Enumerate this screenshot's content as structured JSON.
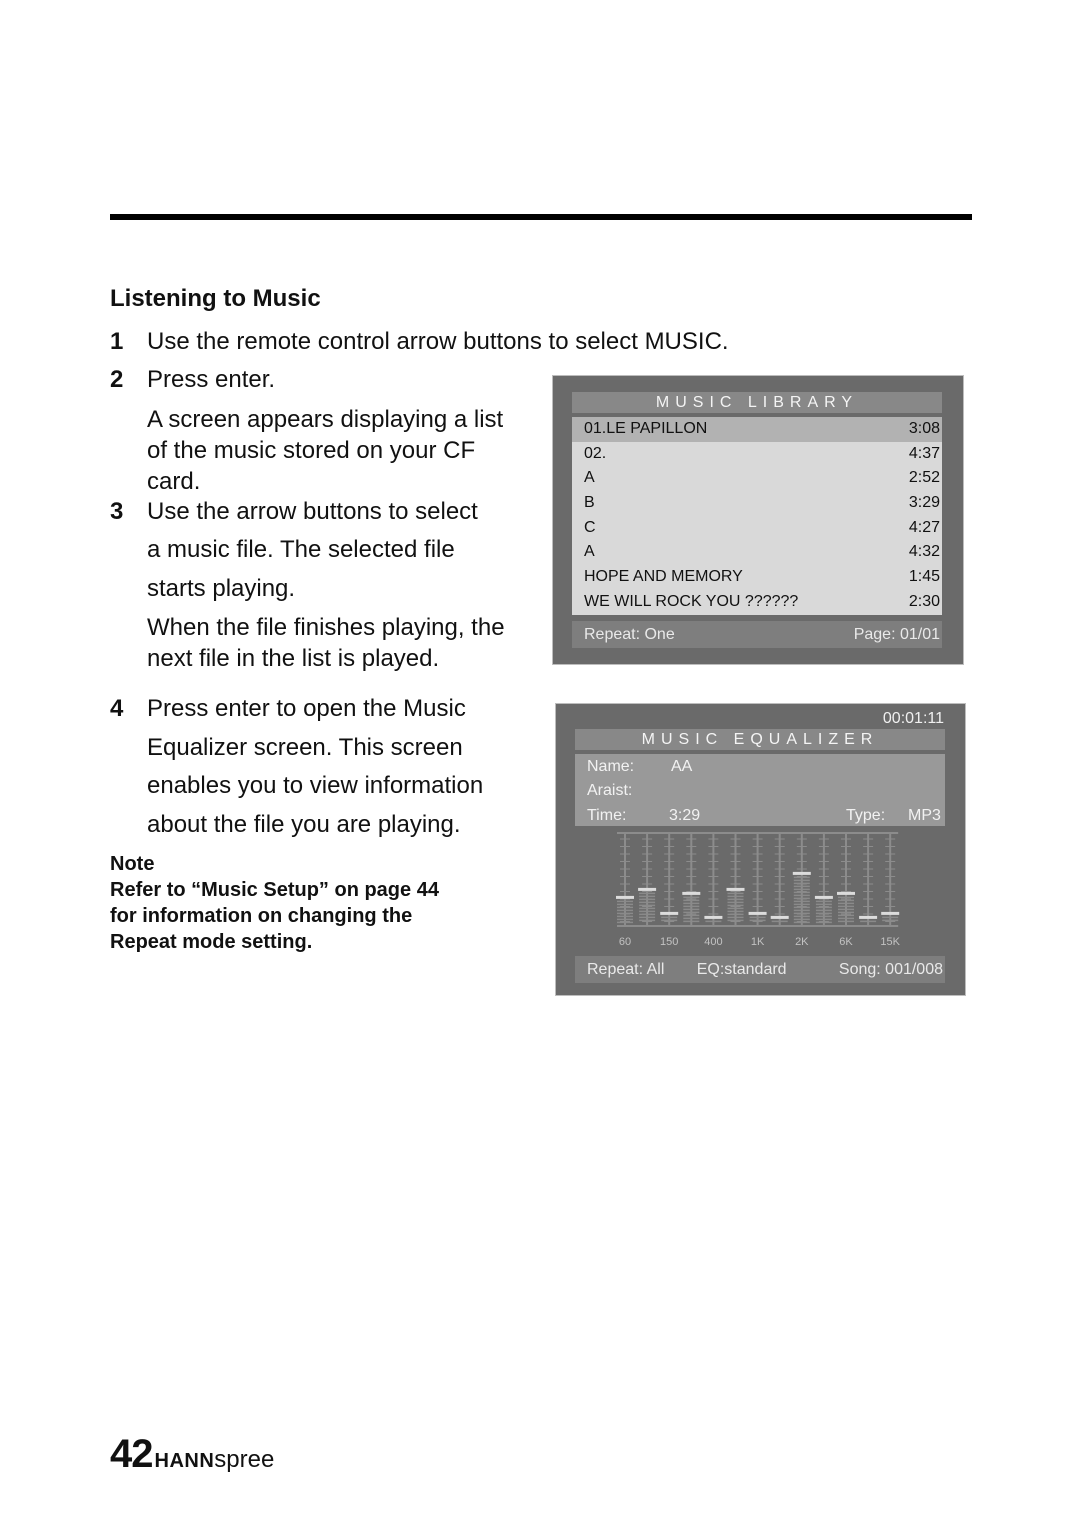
{
  "section_title": "Listening to Music",
  "steps": [
    {
      "num": "1",
      "text": "Use the remote control arrow buttons to select MUSIC."
    },
    {
      "num": "2",
      "text": "Press enter.",
      "detail": "A screen appears displaying a list\nof the music stored on your CF\ncard."
    },
    {
      "num": "3",
      "lines": [
        "Use the arrow buttons to select",
        "a music file. The selected file",
        "starts playing."
      ],
      "detail": "When the file finishes playing, the\nnext file in the list is played."
    },
    {
      "num": "4",
      "lines": [
        "Press enter to open the Music",
        "Equalizer screen. This screen",
        "enables you to view information",
        "about the file you are playing."
      ]
    }
  ],
  "note": {
    "label": "Note",
    "lines": [
      "Refer to “Music Setup” on page 44",
      "for information on changing the",
      "Repeat mode setting."
    ]
  },
  "music_library": {
    "title": "MUSIC LIBRARY",
    "selected_index": 0,
    "tracks": [
      {
        "name": "01.LE PAPILLON",
        "duration": "3:08"
      },
      {
        "name": "02.",
        "duration": "4:37"
      },
      {
        "name": "A",
        "duration": "2:52"
      },
      {
        "name": "B",
        "duration": "3:29"
      },
      {
        "name": "C",
        "duration": "4:27"
      },
      {
        "name": "A",
        "duration": "4:32"
      },
      {
        "name": "HOPE AND MEMORY",
        "duration": "1:45"
      },
      {
        "name": "WE WILL ROCK YOU ??????",
        "duration": "2:30"
      }
    ],
    "repeat": "Repeat: One",
    "page": "Page: 01/01"
  },
  "music_equalizer": {
    "elapsed": "00:01:11",
    "title": "MUSIC EQUALIZER",
    "name_label": "Name:",
    "name_value": "AA",
    "artist_label": "Araist:",
    "artist_value": "",
    "time_label": "Time:",
    "time_value": "3:29",
    "type_label": "Type:",
    "type_value": "MP3",
    "band_labels": [
      "60",
      "150",
      "400",
      "1K",
      "2K",
      "6K",
      "15K"
    ],
    "band_levels": [
      0.32,
      0.42,
      0.12,
      0.37,
      0.07,
      0.42,
      0.12,
      0.07,
      0.62,
      0.32,
      0.37,
      0.07,
      0.12
    ],
    "repeat": "Repeat: All",
    "eq_mode": "EQ:standard",
    "song": "Song: 001/008"
  },
  "footer": {
    "page_number": "42",
    "brand_bold": "HANN",
    "brand_light": "spree"
  }
}
